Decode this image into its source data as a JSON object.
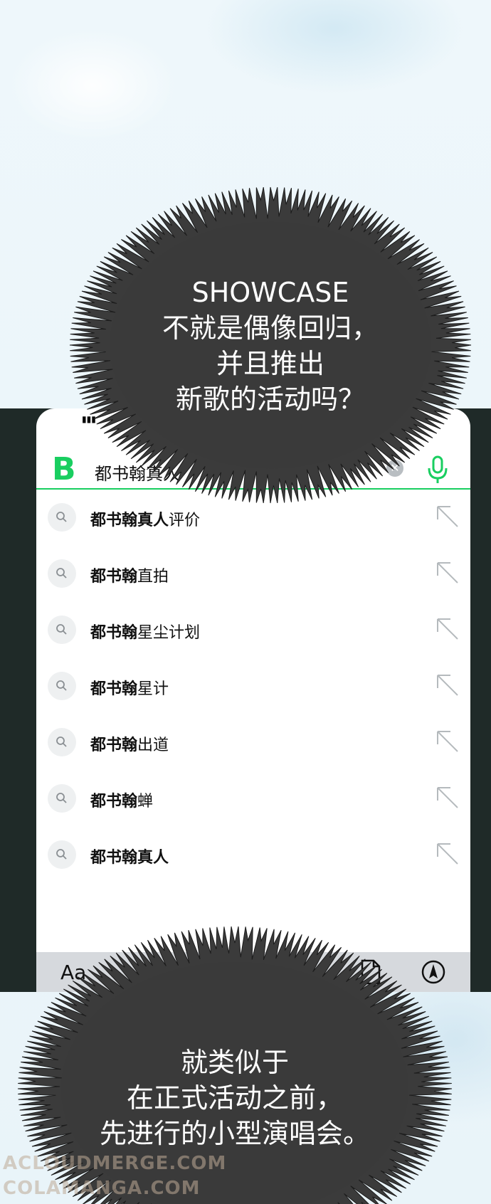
{
  "bubbles": {
    "top": "SHOWCASE\n不就是偶像回归，\n并且推出\n新歌的活动吗？",
    "bottom": "就类似于\n在正式活动之前，\n先进行的小型演唱会。"
  },
  "phone": {
    "status_signal": "▮▮▮",
    "brand_letter": "B",
    "search_value": "都书翰真人",
    "clear_icon": "clear-icon",
    "mic_icon": "microphone-icon",
    "brand_color": "#19ce60",
    "suggestions": [
      {
        "bold": "都书翰真人",
        "rest": "评价"
      },
      {
        "bold": "都书翰",
        "rest": "直拍"
      },
      {
        "bold": "都书翰",
        "rest": "星尘计划"
      },
      {
        "bold": "都书翰",
        "rest": "星计"
      },
      {
        "bold": "都书翰",
        "rest": "出道"
      },
      {
        "bold": "都书翰",
        "rest": "蝉"
      },
      {
        "bold": "都书翰真人",
        "rest": ""
      }
    ],
    "keyboard_toolbar": {
      "aa_label": "Aa",
      "doc_icon": "document-icon",
      "compass_icon": "compass-icon"
    }
  },
  "watermark": {
    "line1": "ACLOUDMERGE.COM",
    "line2": "COLAMANGA.COM"
  }
}
